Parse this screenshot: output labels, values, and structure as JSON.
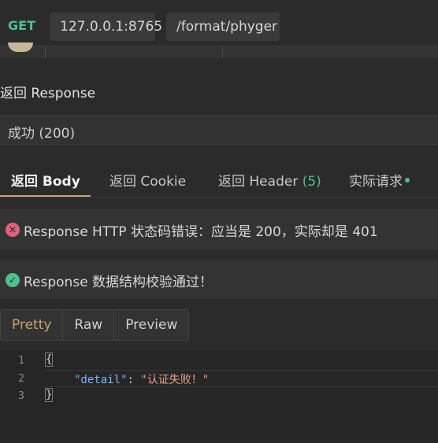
{
  "request": {
    "method": "GET",
    "host": "127.0.0.1:8765",
    "path": "/format/phyger"
  },
  "response": {
    "section_title": "返回 Response",
    "status_text": "成功 (200)"
  },
  "tabs": {
    "body": "返回 Body",
    "cookie": "返回 Cookie",
    "header_label": "返回 Header",
    "header_count": "(5)",
    "actual_request": "实际请求"
  },
  "alerts": {
    "error_text": "Response HTTP 状态码错误：应当是 200，实际却是 401",
    "success_text": "Response 数据结构校验通过！"
  },
  "view_switcher": {
    "pretty": "Pretty",
    "raw": "Raw",
    "preview": "Preview",
    "selected": "Pretty"
  },
  "code": {
    "line_numbers": [
      "1",
      "2",
      "3"
    ],
    "open_brace": "{",
    "key": "\"detail\"",
    "colon": ": ",
    "value": "\"认证失败！\"",
    "close_brace": "}"
  },
  "colors": {
    "accent_green": "#4fc08d",
    "accent_gold": "#c9a36a",
    "error_red": "#e0607a"
  },
  "icons": [
    "error-circle-icon",
    "check-circle-icon"
  ]
}
